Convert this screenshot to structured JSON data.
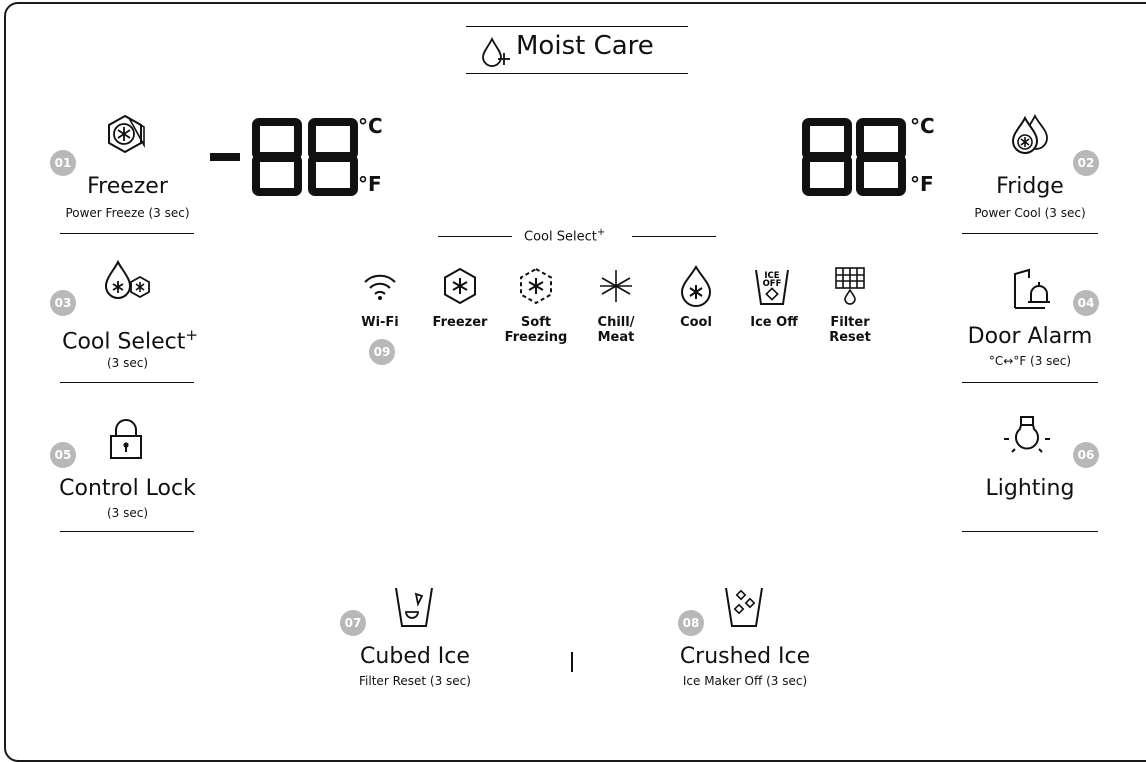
{
  "header": {
    "title": "Moist Care"
  },
  "displays": {
    "freezer": {
      "digits": "-88",
      "unit_c": "°C",
      "unit_f": "°F"
    },
    "fridge": {
      "digits": "88",
      "unit_c": "°C",
      "unit_f": "°F"
    }
  },
  "cool_select_bar": {
    "label": "Cool Select",
    "sup": "+"
  },
  "buttons": {
    "freezer": {
      "number": "01",
      "label": "Freezer",
      "sub": "Power Freeze (3 sec)",
      "icon": "freezer-hex-icon"
    },
    "fridge": {
      "number": "02",
      "label": "Fridge",
      "sub": "Power Cool (3 sec)",
      "icon": "fridge-drops-icon"
    },
    "cool_select": {
      "number": "03",
      "label": "Cool Select",
      "sup": "+",
      "sub": "(3 sec)",
      "icon": "cool-select-icon"
    },
    "door_alarm": {
      "number": "04",
      "label": "Door Alarm",
      "sub": "°C↔°F (3 sec)",
      "icon": "door-alarm-icon"
    },
    "control_lock": {
      "number": "05",
      "label": "Control Lock",
      "sub": "(3 sec)",
      "icon": "lock-icon"
    },
    "lighting": {
      "number": "06",
      "label": "Lighting",
      "sub": "",
      "icon": "bulb-icon"
    },
    "cubed_ice": {
      "number": "07",
      "label": "Cubed Ice",
      "sub": "Filter Reset (3 sec)",
      "icon": "cubed-ice-cup-icon"
    },
    "crushed_ice": {
      "number": "08",
      "label": "Crushed Ice",
      "sub": "Ice Maker Off (3 sec)",
      "icon": "crushed-ice-cup-icon"
    }
  },
  "modes": [
    {
      "line1": "Wi-Fi",
      "line2": "",
      "icon": "wifi-icon"
    },
    {
      "line1": "Freezer",
      "line2": "",
      "icon": "freezer-icon"
    },
    {
      "line1": "Soft",
      "line2": "Freezing",
      "icon": "soft-freezing-icon"
    },
    {
      "line1": "Chill/",
      "line2": "Meat",
      "icon": "chill-meat-icon"
    },
    {
      "line1": "Cool",
      "line2": "",
      "icon": "cool-drop-icon"
    },
    {
      "line1": "Ice Off",
      "line2": "",
      "icon": "ice-off-icon"
    },
    {
      "line1": "Filter",
      "line2": "Reset",
      "icon": "filter-reset-icon"
    }
  ],
  "wifi_badge": "09",
  "ice_off_icon_text": {
    "line1": "ICE",
    "line2": "OFF"
  }
}
